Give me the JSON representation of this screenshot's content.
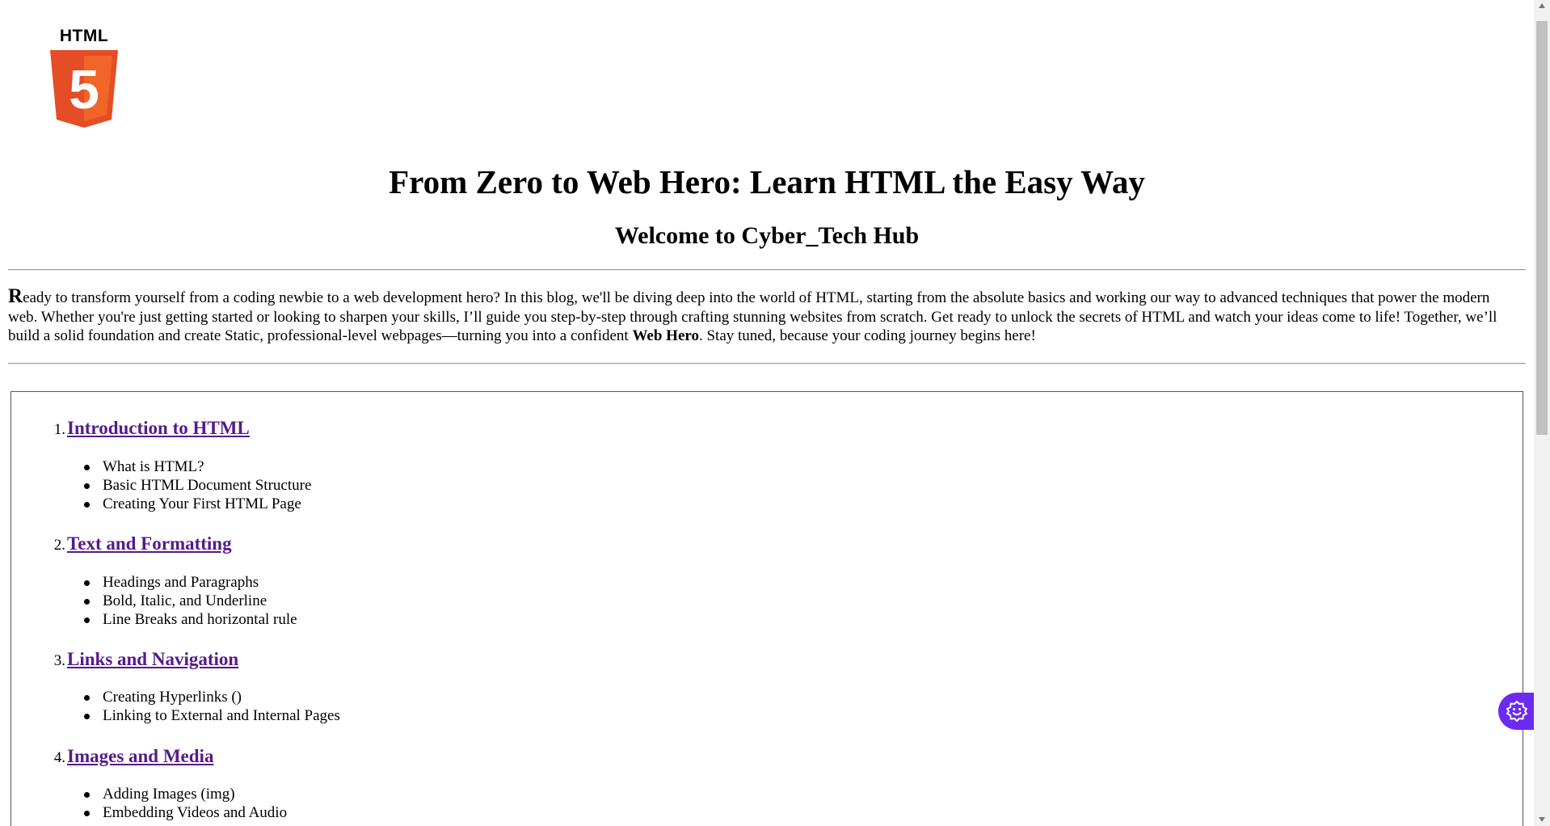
{
  "logo": {
    "word": "HTML",
    "glyph": "5",
    "colors": {
      "shield": "#e44d26",
      "shield_light": "#f16529",
      "glyph": "#ffffff"
    }
  },
  "header": {
    "title": "From Zero to Web Hero: Learn HTML the Easy Way",
    "subtitle": "Welcome to Cyber_Tech Hub"
  },
  "intro": {
    "dropcap": "R",
    "text_before": "eady to transform yourself from a coding newbie to a web development hero? In this blog, we'll be diving deep into the world of HTML, starting from the absolute basics and working our way to advanced techniques that power the modern web. Whether you're just getting started or looking to sharpen your skills, I’ll guide you step-by-step through crafting stunning websites from scratch. Get ready to unlock the secrets of HTML and watch your ideas come to life! Together, we’ll build a solid foundation and create Static, professional-level webpages—turning you into a confident ",
    "bold": "Web Hero",
    "text_after": ". Stay tuned, because your coding journey begins here!"
  },
  "toc": {
    "link_color": "#551a8b",
    "sections": [
      {
        "number": "1.",
        "title": "Introduction to HTML",
        "items": [
          "What is HTML?",
          "Basic HTML Document Structure",
          "Creating Your First HTML Page"
        ]
      },
      {
        "number": "2.",
        "title": "Text and Formatting",
        "items": [
          "Headings and Paragraphs",
          "Bold, Italic, and Underline",
          "Line Breaks and horizontal rule"
        ]
      },
      {
        "number": "3.",
        "title": "Links and Navigation",
        "items": [
          "Creating Hyperlinks ()",
          "Linking to External and Internal Pages"
        ]
      },
      {
        "number": "4.",
        "title": "Images and Media",
        "items": [
          "Adding Images (img)",
          "Embedding Videos and Audio"
        ]
      }
    ]
  },
  "widget": {
    "icon": "smiley-gear-icon",
    "color": "#6c2bf2"
  }
}
